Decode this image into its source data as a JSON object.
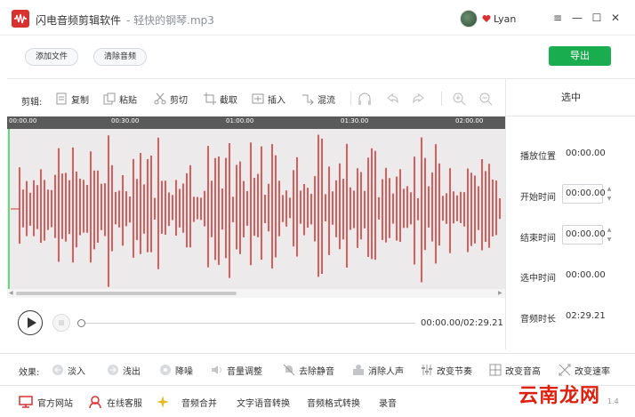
{
  "titlebar": {
    "app_name": "闪电音频剪辑软件",
    "file_name": "- 轻快的钢琴.mp3",
    "username": "Lyan",
    "minimize_glyph": "—",
    "maximize_glyph": "☐",
    "close_glyph": "✕",
    "menu_glyph": "≡"
  },
  "actions": {
    "add_file": "添加文件",
    "clear_audio": "清除音频",
    "export": "导出"
  },
  "toolbar": {
    "label": "剪辑:",
    "copy": "复制",
    "paste": "粘贴",
    "cut": "剪切",
    "crop": "截取",
    "insert": "插入",
    "mix": "混流"
  },
  "timeline": {
    "marks": [
      "00:00.00",
      "00:30.00",
      "01:00.00",
      "01:30.00",
      "02:00.00"
    ]
  },
  "playback": {
    "time": "00:00.00/02:29.21",
    "progress": 0.0
  },
  "side_panel": {
    "title": "选中",
    "play_position_label": "播放位置",
    "play_position_value": "00:00.00",
    "start_time_label": "开始时间",
    "start_time_value": "00:00.00",
    "end_time_label": "结束时间",
    "end_time_value": "00:00.00",
    "selected_time_label": "选中时间",
    "selected_time_value": "00:00.00",
    "duration_label": "音频时长",
    "duration_value": "02:29.21"
  },
  "effects": {
    "label": "效果:",
    "fade_in": "淡入",
    "fade_out": "浅出",
    "denoise": "降噪",
    "volume": "音量调整",
    "remove_silence": "去除静音",
    "remove_vocal": "消除人声",
    "change_tempo": "改变节奏",
    "change_pitch": "改变音高",
    "change_speed": "改变速率"
  },
  "bottom": {
    "website": "官方网站",
    "support": "在线客服",
    "merge": "音频合并",
    "tts": "文字语音转换",
    "format": "音频格式转换",
    "record": "录音",
    "version": "1.4",
    "watermark": "云南龙网"
  },
  "colors": {
    "waveform": "#d33a3a",
    "export_green": "#1aad4f",
    "brand_red": "#d93030"
  }
}
